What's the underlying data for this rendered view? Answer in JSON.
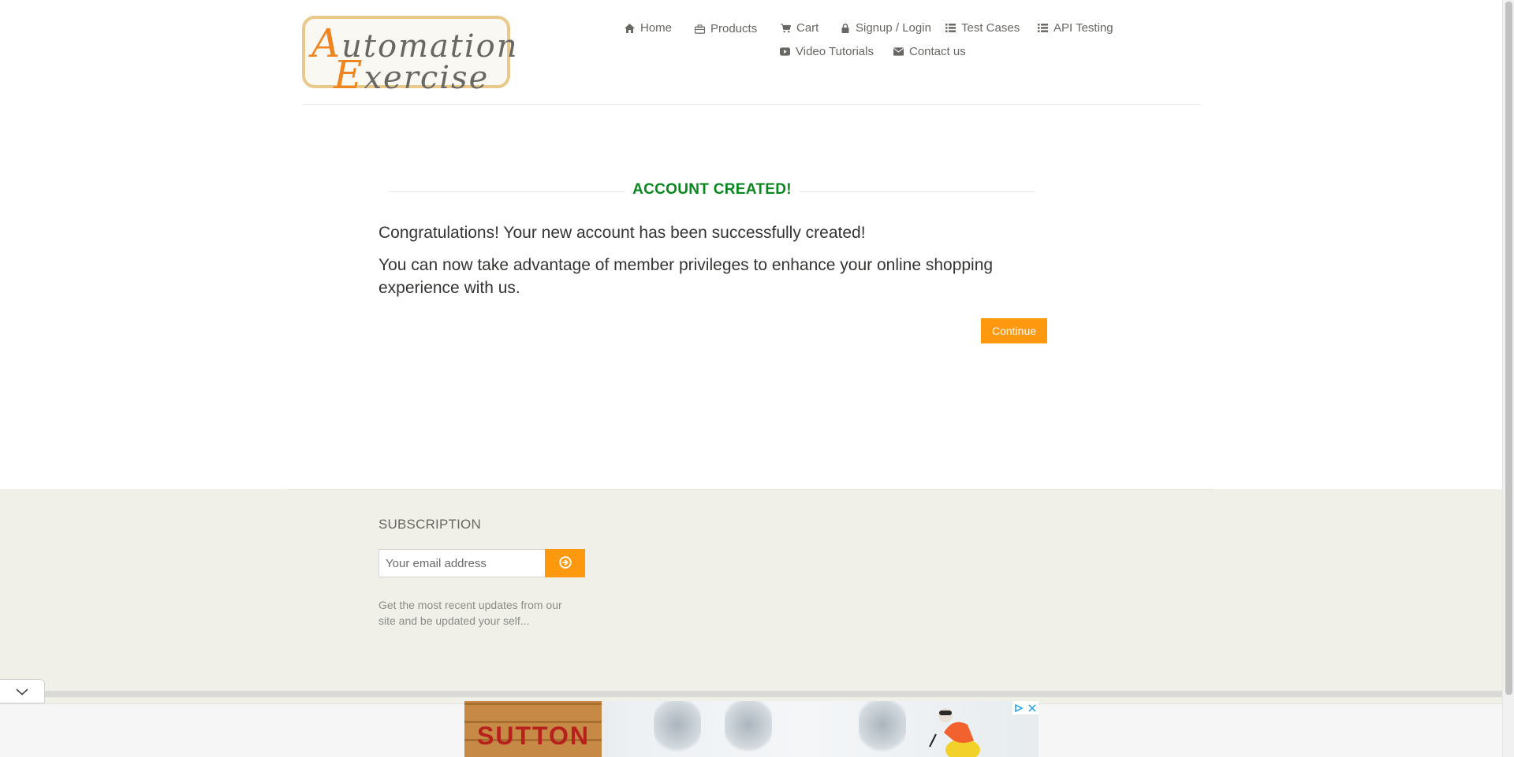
{
  "header": {
    "logo": {
      "line1_cap": "A",
      "line1_rest": "utomation",
      "line2_cap": "E",
      "line2_rest": "xercise"
    },
    "nav": [
      {
        "label": "Home",
        "icon": "home-icon"
      },
      {
        "label": "Products",
        "icon": "products-icon"
      },
      {
        "label": "Cart",
        "icon": "cart-icon"
      },
      {
        "label": "Signup / Login",
        "icon": "lock-icon"
      },
      {
        "label": "Test Cases",
        "icon": "list-icon"
      },
      {
        "label": "API Testing",
        "icon": "list-icon"
      },
      {
        "label": "Video Tutorials",
        "icon": "youtube-icon"
      },
      {
        "label": "Contact us",
        "icon": "envelope-icon"
      }
    ]
  },
  "main": {
    "title": "ACCOUNT CREATED!",
    "message1": "Congratulations! Your new account has been successfully created!",
    "message2": "You can now take advantage of member privileges to enhance your online shopping experience with us.",
    "continue_label": "Continue"
  },
  "footer": {
    "subscription_title": "SUBSCRIPTION",
    "email_placeholder": "Your email address",
    "description": "Get the most recent updates from our site and be updated your self..."
  },
  "ad": {
    "crate_text": "SUTTON"
  },
  "colors": {
    "accent": "#fe980f",
    "success": "#08871e",
    "footer_bg": "#f0f0e9"
  }
}
